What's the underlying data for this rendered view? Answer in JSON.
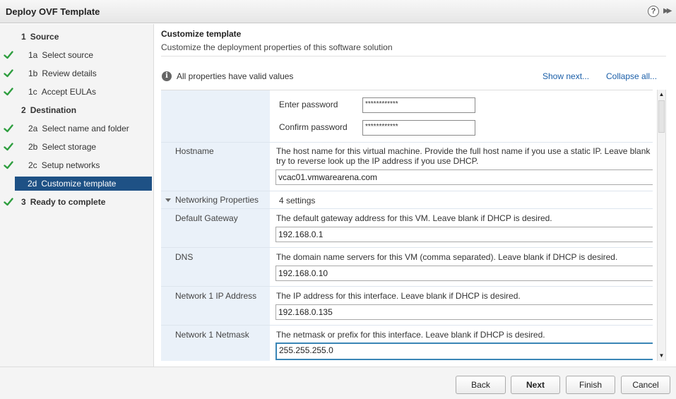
{
  "window": {
    "title": "Deploy OVF Template",
    "help_icon": "?",
    "expand_icon": "▶▶"
  },
  "nav": {
    "items": [
      {
        "num": "1",
        "label": "Source",
        "section": true,
        "done": false
      },
      {
        "num": "1a",
        "label": "Select source",
        "section": false,
        "done": true
      },
      {
        "num": "1b",
        "label": "Review details",
        "section": false,
        "done": true
      },
      {
        "num": "1c",
        "label": "Accept EULAs",
        "section": false,
        "done": true
      },
      {
        "num": "2",
        "label": "Destination",
        "section": true,
        "done": false
      },
      {
        "num": "2a",
        "label": "Select name and folder",
        "section": false,
        "done": true
      },
      {
        "num": "2b",
        "label": "Select storage",
        "section": false,
        "done": true
      },
      {
        "num": "2c",
        "label": "Setup networks",
        "section": false,
        "done": true
      },
      {
        "num": "2d",
        "label": "Customize template",
        "section": false,
        "done": false,
        "selected": true
      },
      {
        "num": "3",
        "label": "Ready to complete",
        "section": true,
        "done": true
      }
    ],
    "check_color": "#2e9e3f",
    "selected_color": "#1e5185"
  },
  "main": {
    "title": "Customize template",
    "subtitle": "Customize the deployment properties of this software solution",
    "valid_text": "All properties have valid values",
    "show_next": "Show next...",
    "collapse_all": "Collapse all...",
    "password": {
      "enter_label": "Enter password",
      "enter_value": "************",
      "confirm_label": "Confirm password",
      "confirm_value": "************"
    },
    "hostname": {
      "label": "Hostname",
      "desc_line1": "The host name for this virtual machine. Provide the full host name if you use a static IP. Leave blank",
      "desc_line2": "try to reverse look up the IP address if you use DHCP.",
      "value": "vcac01.vmwarearena.com"
    },
    "networking": {
      "label": "Networking Properties",
      "settings": "4 settings"
    },
    "gateway": {
      "label": "Default Gateway",
      "desc": "The default gateway address for this VM. Leave blank if DHCP is desired.",
      "value": "192.168.0.1"
    },
    "dns": {
      "label": "DNS",
      "desc": "The domain name servers for this VM (comma separated). Leave blank if DHCP is desired.",
      "value": "192.168.0.10"
    },
    "ip": {
      "label": "Network 1 IP Address",
      "desc": "The IP address for this interface. Leave blank if DHCP is desired.",
      "value": "192.168.0.135"
    },
    "netmask": {
      "label": "Network 1 Netmask",
      "desc": "The netmask or prefix for this interface. Leave blank if DHCP is desired.",
      "value": "255.255.255.0"
    }
  },
  "footer": {
    "back": "Back",
    "next": "Next",
    "finish": "Finish",
    "cancel": "Cancel"
  }
}
